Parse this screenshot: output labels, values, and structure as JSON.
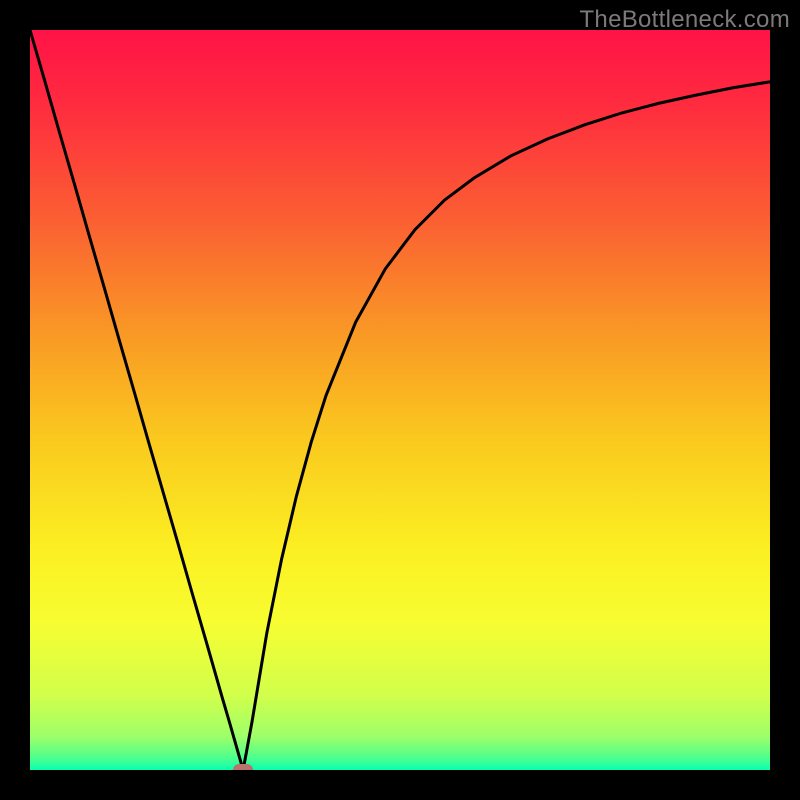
{
  "watermark": "TheBottleneck.com",
  "colors": {
    "frame": "#000000",
    "curve": "#000000",
    "marker": "#b97369"
  },
  "chart_data": {
    "type": "line",
    "title": "",
    "xlabel": "",
    "ylabel": "",
    "xlim": [
      0,
      100
    ],
    "ylim": [
      0,
      100
    ],
    "grid": false,
    "gradient_stops": [
      {
        "offset": 0.0,
        "color": "#ff1347"
      },
      {
        "offset": 0.1,
        "color": "#ff2b3f"
      },
      {
        "offset": 0.25,
        "color": "#fb5d33"
      },
      {
        "offset": 0.4,
        "color": "#f99526"
      },
      {
        "offset": 0.55,
        "color": "#fac81e"
      },
      {
        "offset": 0.7,
        "color": "#fbef22"
      },
      {
        "offset": 0.8,
        "color": "#f7fd31"
      },
      {
        "offset": 0.9,
        "color": "#d1ff4b"
      },
      {
        "offset": 0.955,
        "color": "#9dff69"
      },
      {
        "offset": 0.985,
        "color": "#4aff90"
      },
      {
        "offset": 1.0,
        "color": "#08ffb0"
      }
    ],
    "series": [
      {
        "name": "bottleneck",
        "x": [
          0,
          2,
          4,
          6,
          8,
          10,
          12,
          14,
          16,
          18,
          20,
          22,
          24,
          26,
          27,
          28,
          28.8,
          30,
          32,
          34,
          36,
          38,
          40,
          44,
          48,
          52,
          56,
          60,
          65,
          70,
          75,
          80,
          85,
          90,
          95,
          100
        ],
        "values": [
          100.0,
          93.1,
          86.1,
          79.2,
          72.2,
          65.3,
          58.3,
          51.4,
          44.4,
          37.5,
          30.6,
          23.6,
          16.7,
          9.7,
          6.3,
          2.8,
          0.0,
          6.5,
          18.5,
          28.5,
          37.0,
          44.3,
          50.6,
          60.5,
          67.7,
          73.0,
          77.0,
          80.0,
          83.0,
          85.3,
          87.2,
          88.8,
          90.1,
          91.2,
          92.2,
          93.0
        ]
      }
    ],
    "marker": {
      "x": 28.8,
      "y": 0.0
    }
  }
}
